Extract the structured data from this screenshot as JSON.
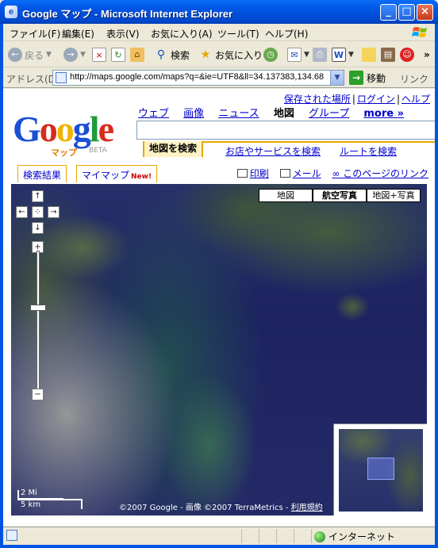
{
  "window": {
    "title": "Google マップ - Microsoft Internet Explorer",
    "buttons": {
      "minimize": "_",
      "maximize": "□",
      "close": "×"
    }
  },
  "menu": [
    "ファイル(F)",
    "編集(E)",
    "表示(V)",
    "お気に入り(A)",
    "ツール(T)",
    "ヘルプ(H)"
  ],
  "toolbar": {
    "back": "戻る",
    "search": "検索",
    "favorites": "お気に入り",
    "chevron": "»"
  },
  "address": {
    "label": "アドレス(D)",
    "url": "http://maps.google.com/maps?q=&ie=UTF8&ll=34.137383,134.680",
    "go": "移動",
    "links": "リンク"
  },
  "page": {
    "top_links": [
      "保存された場所",
      "ログイン",
      "ヘルプ"
    ],
    "logo": {
      "letters": [
        "G",
        "o",
        "o",
        "g",
        "l",
        "e"
      ],
      "colors": [
        "#1a4fd6",
        "#d72b1c",
        "#f0b400",
        "#1a4fd6",
        "#1f9b3a",
        "#d72b1c"
      ],
      "sub": "マップ",
      "beta": "BETA"
    },
    "search_tabs": [
      "ウェブ",
      "画像",
      "ニュース",
      "地図",
      "グループ",
      "more »"
    ],
    "active_search_tab": "地図",
    "search_value": "",
    "sub_tabs": [
      "地図を検索",
      "お店やサービスを検索",
      "ルートを検索"
    ],
    "panel_tabs": {
      "results": "検索結果",
      "mymaps": "マイマップ",
      "new_badge": "New!"
    },
    "actions": [
      "印刷",
      "メール",
      "このページのリンク"
    ]
  },
  "map": {
    "types": [
      "地図",
      "航空写真",
      "地図+写真"
    ],
    "active_type": "航空写真",
    "nav": {
      "up": "↑",
      "left": "←",
      "center": "⁘",
      "right": "→",
      "down": "↓",
      "zoom_in": "+",
      "zoom_out": "−"
    },
    "zoom_level": 0.55,
    "scale": {
      "miles": "2 Mi",
      "km": "5 km"
    },
    "copyright": {
      "text": "©2007 Google - 画像 ©2007 TerraMetrics - ",
      "terms": "利用規約"
    }
  },
  "status": {
    "zone": "インターネット"
  }
}
